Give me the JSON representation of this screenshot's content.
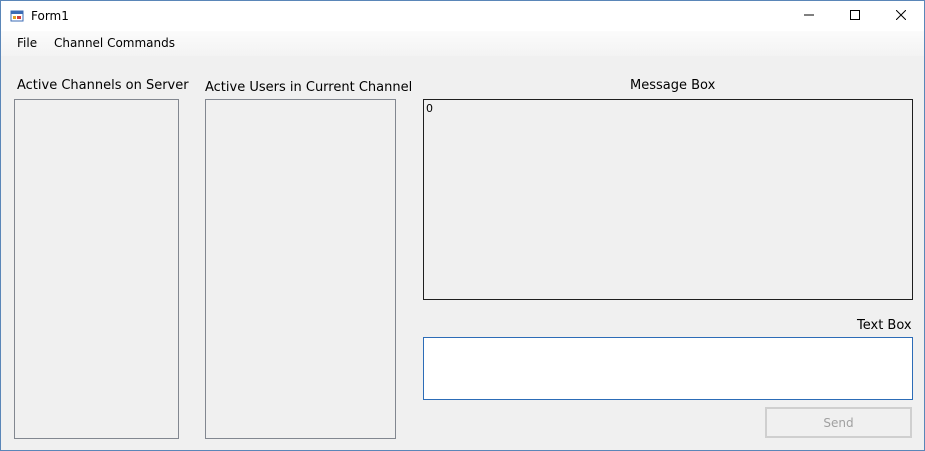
{
  "window": {
    "title": "Form1",
    "app_icon": "form-app-icon",
    "controls": [
      "minimize-icon",
      "maximize-icon",
      "close-icon"
    ]
  },
  "menu": {
    "file": "File",
    "channel_commands": "Channel Commands"
  },
  "labels": {
    "channels": "Active Channels on Server",
    "users": "Active Users in Current Channel",
    "message_box": "Message Box",
    "text_box": "Text Box"
  },
  "message_box": {
    "content": "0"
  },
  "text_box": {
    "value": ""
  },
  "send_button": {
    "label": "Send",
    "enabled": false
  },
  "colors": {
    "accent_border": "#2c6cb7",
    "disabled_text": "#a0a0a0"
  }
}
